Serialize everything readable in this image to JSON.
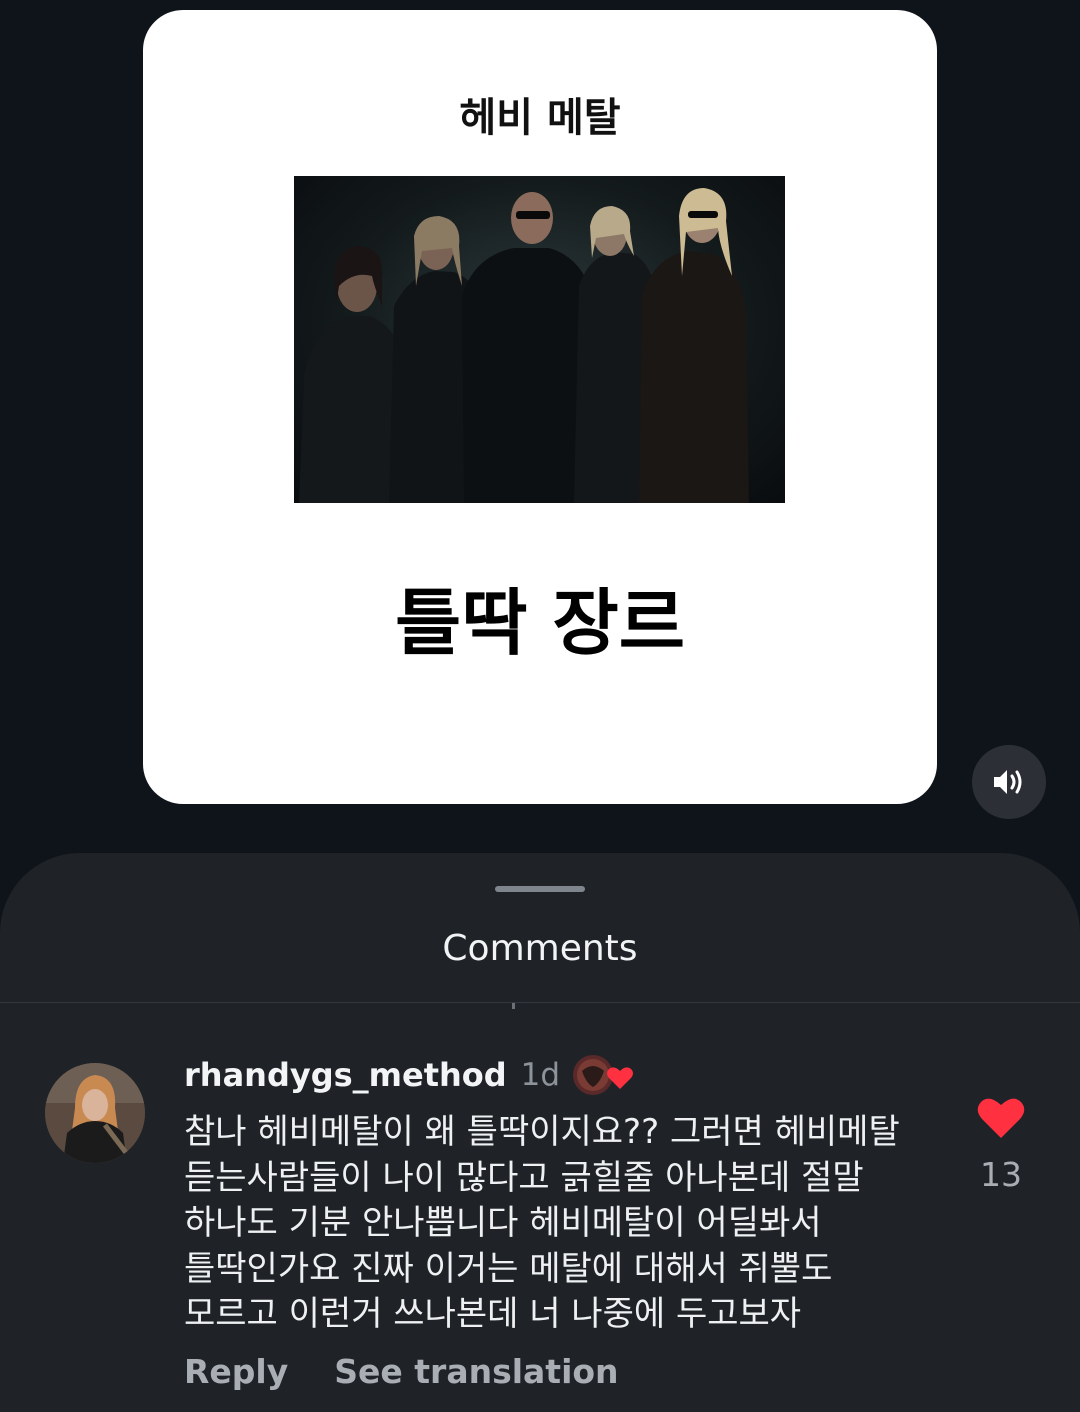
{
  "post": {
    "top_title": "헤비 메탈",
    "bottom_title": "틀딱 장르",
    "photo_icon": "band-photo"
  },
  "sound_button": {
    "icon": "speaker-icon"
  },
  "comments_sheet": {
    "title": "Comments"
  },
  "comment": {
    "username": "rhandygs_method",
    "time": "1d",
    "text": "참나 헤비메탈이 왜 틀딱이지요?? 그러면 헤비메탈 듣는사람들이 나이 많다고 긁힐줄 아나본데 절말 하나도 기분 안나쁩니다 헤비메탈이 어딜봐서 틀딱인가요 진짜 이거는 메탈에 대해서 쥐뿔도 모르고 이런거 쓰나본데 너 나중에 두고보자",
    "reply_label": "Reply",
    "translate_label": "See translation",
    "like_count": "13",
    "like_color": "#ff3040"
  }
}
